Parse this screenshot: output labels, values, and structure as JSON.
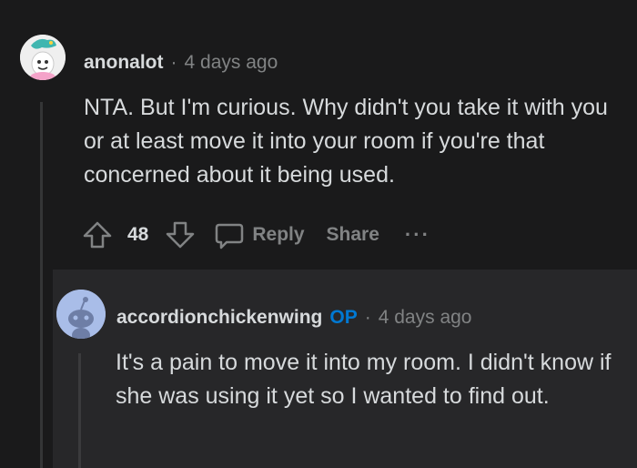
{
  "top_comment": {
    "username": "anonalot",
    "separator": "·",
    "time": "4 days ago",
    "body": "NTA. But I'm curious. Why didn't you take it with you or at least move it into your room if you're that concerned about it being used.",
    "score": "48",
    "actions": {
      "reply": "Reply",
      "share": "Share",
      "more": "···"
    }
  },
  "reply_comment": {
    "username": "accordionchickenwing",
    "op_badge": "OP",
    "separator": "·",
    "time": "4 days ago",
    "body": "It's a pain to move it into my room. I didn't know if she was using it yet so I wanted to find out."
  },
  "colors": {
    "background": "#1a1a1b",
    "reply_background": "#272729",
    "text": "#d7dadc",
    "muted": "#818384",
    "op_accent": "#0079d3"
  },
  "icons": [
    "upvote-icon",
    "downvote-icon",
    "reply-icon",
    "user-avatar",
    "snoo-avatar"
  ]
}
